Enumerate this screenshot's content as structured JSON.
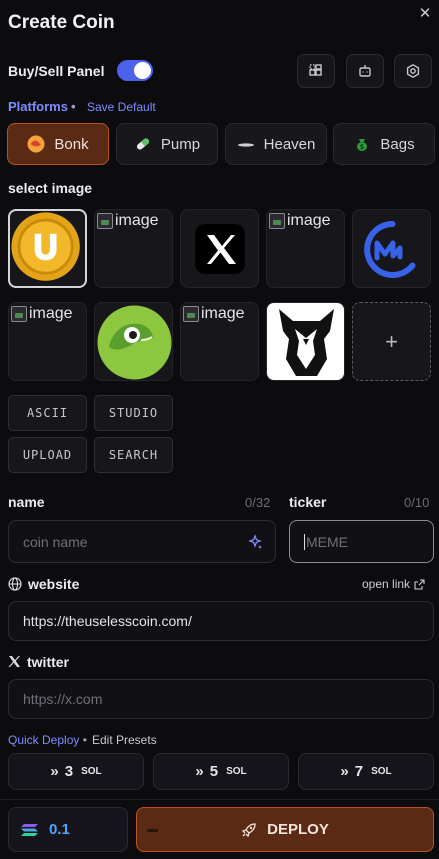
{
  "header": {
    "title": "Create Coin",
    "close_icon": "close-icon"
  },
  "panel": {
    "label": "Buy/Sell Panel",
    "toggle_on": true
  },
  "toolbar_icons": [
    "layout-grid-icon",
    "robot-icon",
    "settings-icon"
  ],
  "platforms": {
    "label": "Platforms",
    "separator": "•",
    "save_default": "Save Default",
    "items": [
      {
        "label": "Bonk",
        "icon": "bonk-icon",
        "active": true
      },
      {
        "label": "Pump",
        "icon": "pill-icon",
        "active": false
      },
      {
        "label": "Heaven",
        "icon": "heaven-icon",
        "active": false
      },
      {
        "label": "Bags",
        "icon": "bag-icon",
        "active": false
      }
    ]
  },
  "images": {
    "label": "select image",
    "broken_alt": "image",
    "tiles": [
      "useless-coin-logo",
      "broken-image",
      "x-logo",
      "broken-image",
      "coinmarketcap-logo",
      "broken-image",
      "coingecko-logo",
      "broken-image",
      "owl-logo",
      "add"
    ],
    "add_symbol": "+"
  },
  "tools": [
    "ASCII",
    "STUDIO",
    "UPLOAD",
    "SEARCH"
  ],
  "name": {
    "label": "name",
    "count": "0/32",
    "placeholder": "coin name"
  },
  "ticker": {
    "label": "ticker",
    "count": "0/10",
    "placeholder": "MEME"
  },
  "website": {
    "label": "website",
    "open_link": "open link",
    "value": "https://theuselesscoin.com/"
  },
  "twitter": {
    "label": "twitter",
    "placeholder": "https://x.com"
  },
  "quick_deploy": {
    "label": "Quick Deploy",
    "separator": "•",
    "edit_presets": "Edit Presets",
    "presets": [
      {
        "amount": "3",
        "unit": "SOL"
      },
      {
        "amount": "5",
        "unit": "SOL"
      },
      {
        "amount": "7",
        "unit": "SOL"
      }
    ]
  },
  "footer": {
    "amount": "0.1",
    "deploy_label": "DEPLOY"
  },
  "colors": {
    "accent": "#7f8cff",
    "active_platform": "#5a2a14",
    "active_border": "#b5521f",
    "toggle": "#4b63ec",
    "amount": "#49a7ff"
  }
}
